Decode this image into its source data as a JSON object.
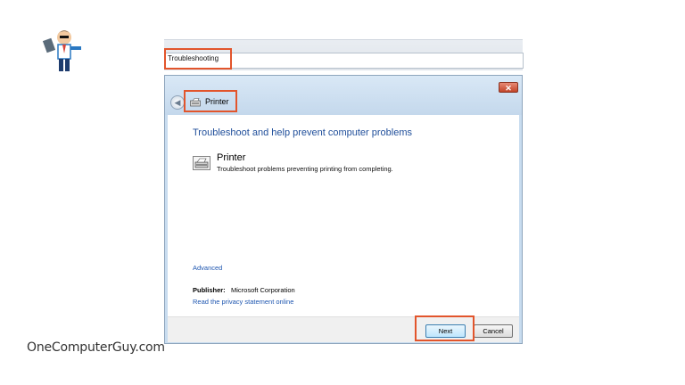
{
  "search": {
    "value": "Troubleshooting"
  },
  "window": {
    "close_glyph": "✕",
    "back_glyph": "◀",
    "breadcrumb": "Printer"
  },
  "content": {
    "heading": "Troubleshoot and help prevent computer problems",
    "item_title": "Printer",
    "item_description": "Troubleshoot problems preventing printing from completing.",
    "advanced_link": "Advanced",
    "publisher_label": "Publisher:",
    "publisher_value": "Microsoft Corporation",
    "privacy_link": "Read the privacy statement online"
  },
  "buttons": {
    "next": "Next",
    "cancel": "Cancel"
  },
  "watermark": "OneComputerGuy.com",
  "colors": {
    "highlight": "#e2552c",
    "link": "#1e56b0",
    "heading": "#1f4e9a"
  },
  "icons": [
    "logo-figure-icon",
    "printer-icon",
    "back-arrow-icon",
    "close-icon"
  ]
}
